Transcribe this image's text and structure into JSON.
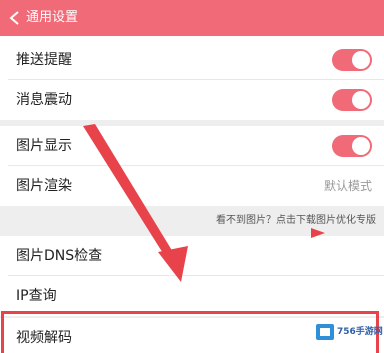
{
  "header": {
    "title": "通用设置",
    "back_icon": "chevron-left-icon"
  },
  "settings": {
    "push_notify": {
      "label": "推送提醒",
      "enabled": true
    },
    "vibrate": {
      "label": "消息震动",
      "enabled": true
    },
    "image_display": {
      "label": "图片显示",
      "enabled": true
    },
    "image_render": {
      "label": "图片渲染",
      "value": "默认模式"
    },
    "hint": "看不到图片？点击下载图片优化专版",
    "dns_check": {
      "label": "图片DNS检查"
    },
    "ip_query": {
      "label": "IP查询"
    },
    "video_decode": {
      "label": "视频解码"
    }
  },
  "watermark": {
    "text": "756手游网"
  },
  "colors": {
    "accent": "#f06a78",
    "annotation_red": "#e8434b",
    "background": "#ffffff",
    "group_gap": "#eeeeee"
  }
}
